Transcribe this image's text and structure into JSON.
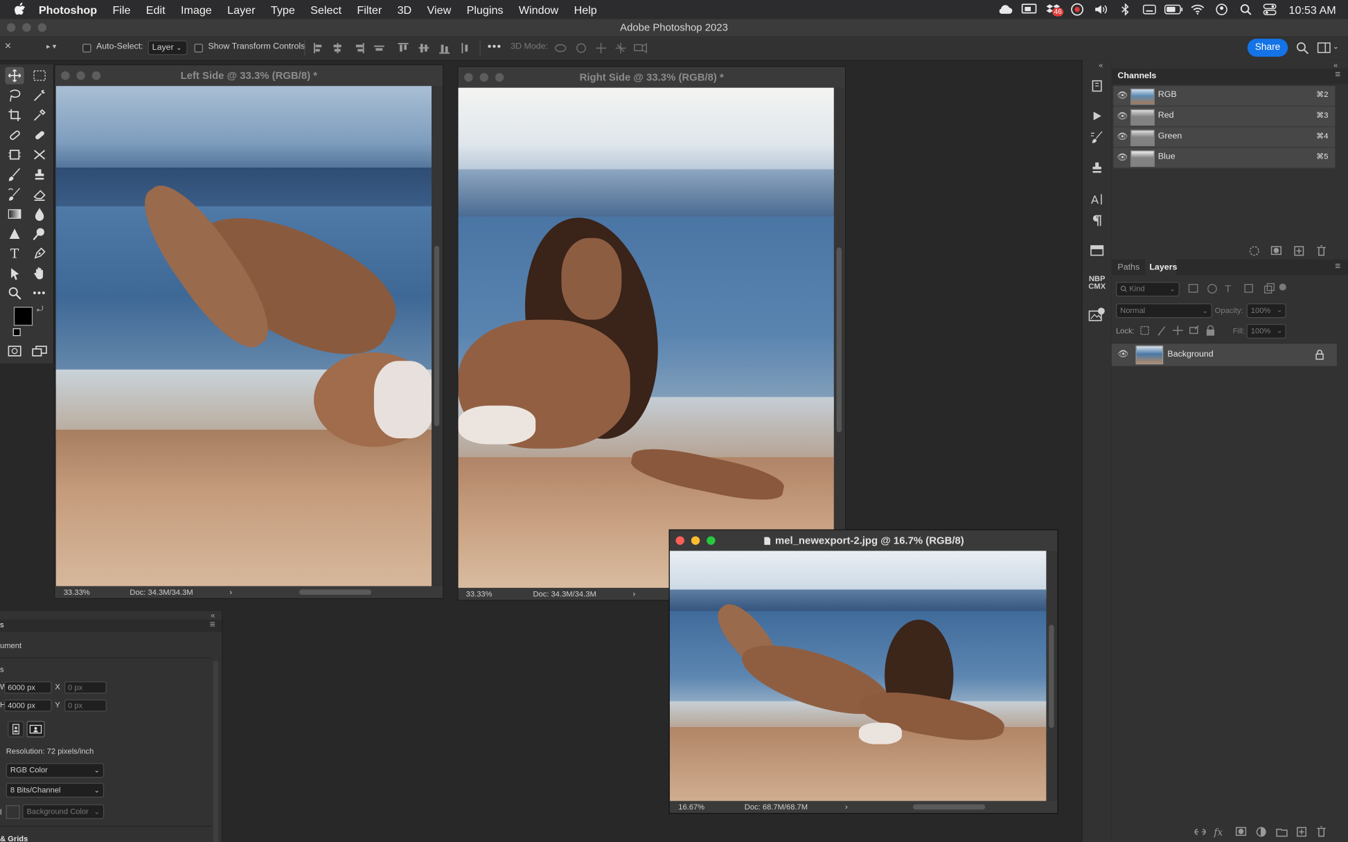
{
  "menubar": {
    "app": "Photoshop",
    "items": [
      "File",
      "Edit",
      "Image",
      "Layer",
      "Type",
      "Select",
      "Filter",
      "3D",
      "View",
      "Plugins",
      "Window",
      "Help"
    ],
    "badge": "46",
    "clock": "10:53 AM"
  },
  "app_title": "Adobe Photoshop 2023",
  "options": {
    "auto_select": "Auto-Select:",
    "auto_select_value": "Layer",
    "show_transform": "Show Transform Controls",
    "mode3d": "3D Mode:",
    "share": "Share"
  },
  "documents": {
    "left": {
      "title": "Left Side @ 33.3% (RGB/8) *",
      "zoom": "33.33%",
      "doc": "Doc: 34.3M/34.3M"
    },
    "right": {
      "title": "Right Side @ 33.3% (RGB/8) *",
      "zoom": "33.33%",
      "doc": "Doc: 34.3M/34.3M"
    },
    "export": {
      "title": "mel_newexport-2.jpg @ 16.7% (RGB/8)",
      "zoom": "16.67%",
      "doc": "Doc: 68.7M/68.7M"
    }
  },
  "channels": {
    "title": "Channels",
    "rows": [
      {
        "name": "RGB",
        "shortcut": "⌘2"
      },
      {
        "name": "Red",
        "shortcut": "⌘3"
      },
      {
        "name": "Green",
        "shortcut": "⌘4"
      },
      {
        "name": "Blue",
        "shortcut": "⌘5"
      }
    ]
  },
  "layers": {
    "tabs": [
      "Paths",
      "Layers"
    ],
    "kind": "Kind",
    "blend": "Normal",
    "opacity_label": "Opacity:",
    "opacity_value": "100%",
    "lock_label": "Lock:",
    "fill_label": "Fill:",
    "fill_value": "100%",
    "items": [
      {
        "name": "Background"
      }
    ]
  },
  "dock": {
    "nbp": "NBP",
    "cmx": "CMX"
  },
  "properties": {
    "tab_fragment": "s",
    "document_label": "ument",
    "section_s": "s",
    "w_label": "W",
    "w_value": "6000 px",
    "h_label": "H",
    "h_value": "4000 px",
    "x_label": "X",
    "x_value": "0 px",
    "y_label": "Y",
    "y_value": "0 px",
    "resolution": "Resolution: 72 pixels/inch",
    "color_mode": "RGB Color",
    "bit_depth": "8 Bits/Channel",
    "fill_prefix": "l",
    "background": "Background Color",
    "grids": "& Grids"
  },
  "colors": {
    "accent": "#1473e6",
    "menubar": "#2c2c2e",
    "panel": "#323232",
    "workspace": "#282828",
    "close_red": "#fe5f57",
    "min_yellow": "#febc2e",
    "max_green": "#28c840"
  }
}
